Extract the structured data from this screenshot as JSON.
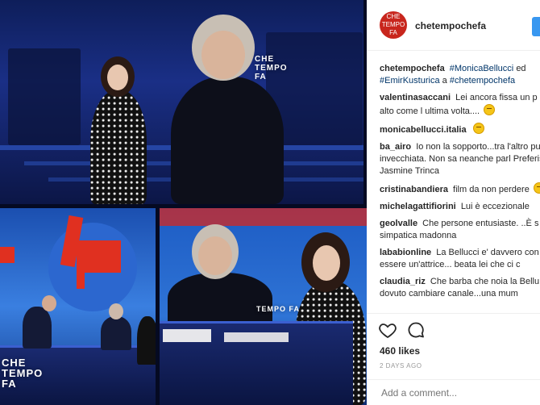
{
  "photo": {
    "brand_top": "CHE TEMPO FA",
    "brand_bottom_left": "CHE TEMPO FA",
    "brand_bottom_right": "TEMPO FA"
  },
  "header": {
    "avatar_line1": "CHE",
    "avatar_line2": "TEMPO",
    "avatar_line3": "FA",
    "username": "chetempochefa",
    "accent": "#3897f0",
    "avatar_color": "#c8261d"
  },
  "caption": {
    "user": "chetempochefa",
    "tag1": "#MonicaBellucci",
    "text1": "ed",
    "tag2": "#EmirKusturica",
    "text2": "a",
    "tag3": "#chetempochefa"
  },
  "comments": [
    {
      "user": "valentinasaccani",
      "text": "Lei ancora fissa un p in alto come l ultima volta....",
      "emoji": "neutral-face-emoji"
    },
    {
      "user": "monicabellucci.italia",
      "text": "",
      "emoji": "neutral-face-emoji"
    },
    {
      "user": "ba_airo",
      "text": "Io non la sopporto...tra l'altro pure invecchiata. Non sa neanche parl Preferisco Jasmine Trinca",
      "emoji": ""
    },
    {
      "user": "cristinabandiera",
      "text": "film da non perdere",
      "emoji": "grin-emoji"
    },
    {
      "user": "michelagattifiorini",
      "text": "Lui è eccezionale",
      "emoji": ""
    },
    {
      "user": "geolvalle",
      "text": "Che persone entusiaste. ..È s più simpatica madonna",
      "emoji": ""
    },
    {
      "user": "lababionline",
      "text": "La Bellucci e' davvero con di essere un'attrice... beata lei che ci c",
      "emoji": ""
    },
    {
      "user": "claudia_riz",
      "text": "Che barba che noia la Bellu Ho dovuto cambiare canale...una mum",
      "emoji": ""
    }
  ],
  "actions": {
    "like_icon": "heart-icon",
    "comment_icon": "speech-bubble-icon"
  },
  "likes": "460 likes",
  "posted": "2 DAYS AGO",
  "add_comment_placeholder": "Add a comment..."
}
